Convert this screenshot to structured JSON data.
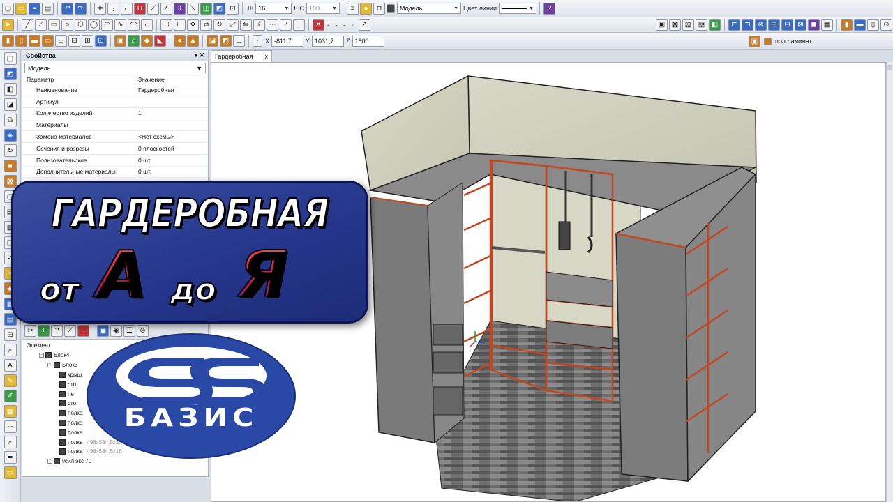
{
  "toolbar": {
    "width_label": "Ш",
    "width_value": "16",
    "hs_label": "ШС",
    "hs_value": "100",
    "layer_value": "Модель",
    "line_color_label": "Цвет линии",
    "coords": {
      "x_label": "X",
      "x_value": "-811,7",
      "y_label": "Y",
      "y_value": "1031,7",
      "z_label": "Z",
      "z_value": "1800"
    },
    "material_label": "пол ламинат"
  },
  "properties": {
    "title": "Свойства",
    "close_glyph": "▾ ✕",
    "combo_value": "Модель",
    "col_param": "Параметр",
    "col_value": "Значение",
    "rows": [
      {
        "param": "Наименование",
        "value": "Гардеробная"
      },
      {
        "param": "Артикул",
        "value": ""
      },
      {
        "param": "Количество изделий",
        "value": "1"
      },
      {
        "param": "Материалы",
        "value": ""
      },
      {
        "param": "Замена материалов",
        "value": "<Нет схемы>"
      },
      {
        "param": "Сечения и разрезы",
        "value": "0 плоскостей"
      },
      {
        "param": "Пользовательские",
        "value": "0 шт."
      },
      {
        "param": "Дополнительные материалы",
        "value": "0 шт."
      }
    ]
  },
  "tree": {
    "header": "Элемент",
    "items": [
      {
        "label": "Блок4",
        "dim": "",
        "level": 1,
        "expander": "−"
      },
      {
        "label": "Блок3",
        "dim": "",
        "level": 2,
        "expander": "+"
      },
      {
        "label": "крыш",
        "dim": "",
        "level": 3,
        "expander": ""
      },
      {
        "label": "сто",
        "dim": "",
        "level": 3,
        "expander": ""
      },
      {
        "label": "пе",
        "dim": "",
        "level": 3,
        "expander": ""
      },
      {
        "label": "сто",
        "dim": "",
        "level": 3,
        "expander": ""
      },
      {
        "label": "полка",
        "dim": "",
        "level": 3,
        "expander": ""
      },
      {
        "label": "полка",
        "dim": "",
        "level": 3,
        "expander": ""
      },
      {
        "label": "полка",
        "dim": "",
        "level": 3,
        "expander": ""
      },
      {
        "label": "полка",
        "dim": "498x584,5x16",
        "level": 3,
        "expander": ""
      },
      {
        "label": "полка",
        "dim": "498x584,5x16",
        "level": 3,
        "expander": ""
      },
      {
        "label": "усил экс 70",
        "dim": "",
        "level": 2,
        "expander": "+"
      }
    ]
  },
  "viewport": {
    "tab_label": "Гардеробная",
    "tab_close": "x"
  },
  "banner": {
    "title": "ГАРДЕРОБНАЯ",
    "from": "от",
    "letter_a": "А",
    "to": "до",
    "letter_ya": "Я"
  },
  "logo": {
    "text": "БАЗИС"
  },
  "colors": {
    "banner_bg": "#2a3c90",
    "logo_blue": "#2a48a6",
    "cabinet_edge": "#c2471f",
    "cabinet_gray": "#7a7a7a"
  }
}
